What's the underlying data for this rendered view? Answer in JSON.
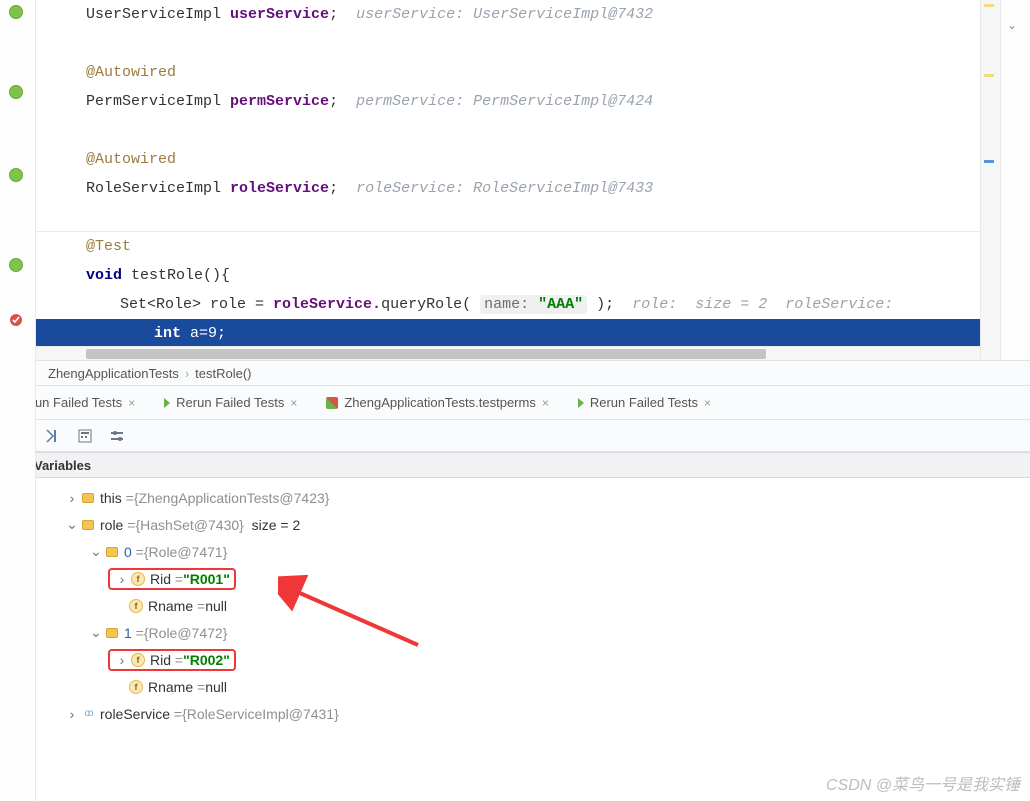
{
  "editor": {
    "line0": {
      "type": "UserServiceImpl",
      "field": "userService",
      "cmt": "userService: UserServiceImpl@7432"
    },
    "autowired": "@Autowired",
    "line2": {
      "type": "PermServiceImpl",
      "field": "permService",
      "cmt": "permService: PermServiceImpl@7424"
    },
    "line4": {
      "type": "RoleServiceImpl",
      "field": "roleService",
      "cmt": "roleService: RoleServiceImpl@7433"
    },
    "test": "@Test",
    "sig": {
      "kw": "void",
      "name": "testRole",
      "paren": "(){"
    },
    "line7": {
      "pre": "Set<Role> role = ",
      "call1": "roleService.",
      "call2": "queryRole",
      "paramBox": "name: \"AAA\"",
      "close": ");",
      "cmt": "role:  size = 2  roleService:"
    },
    "curLine": "int a=9;",
    "brace": "}"
  },
  "breadcrumb": {
    "a": "ZhengApplicationTests",
    "b": "testRole()"
  },
  "debugTabs": {
    "t1": "Rerun Failed Tests",
    "t2": "Rerun Failed Tests",
    "t3": "ZhengApplicationTests.testperms",
    "t4": "Rerun Failed Tests"
  },
  "varHeader": "Variables",
  "vars": {
    "this": {
      "name": "this",
      "val": "{ZhengApplicationTests@7423}"
    },
    "role": {
      "name": "role",
      "val": "{HashSet@7430}",
      "size": "size = 2"
    },
    "r0": {
      "idx": "0",
      "val": "{Role@7471}"
    },
    "r0_rid": {
      "name": "Rid",
      "val": "\"R001\""
    },
    "r0_rname": {
      "name": "Rname",
      "val": "null"
    },
    "r1": {
      "idx": "1",
      "val": "{Role@7472}"
    },
    "r1_rid": {
      "name": "Rid",
      "val": "\"R002\""
    },
    "r1_rname": {
      "name": "Rname",
      "val": "null"
    },
    "rs": {
      "name": "roleService",
      "val": "{RoleServiceImpl@7431}"
    }
  },
  "watermark": "CSDN @菜鸟一号是我实锤"
}
